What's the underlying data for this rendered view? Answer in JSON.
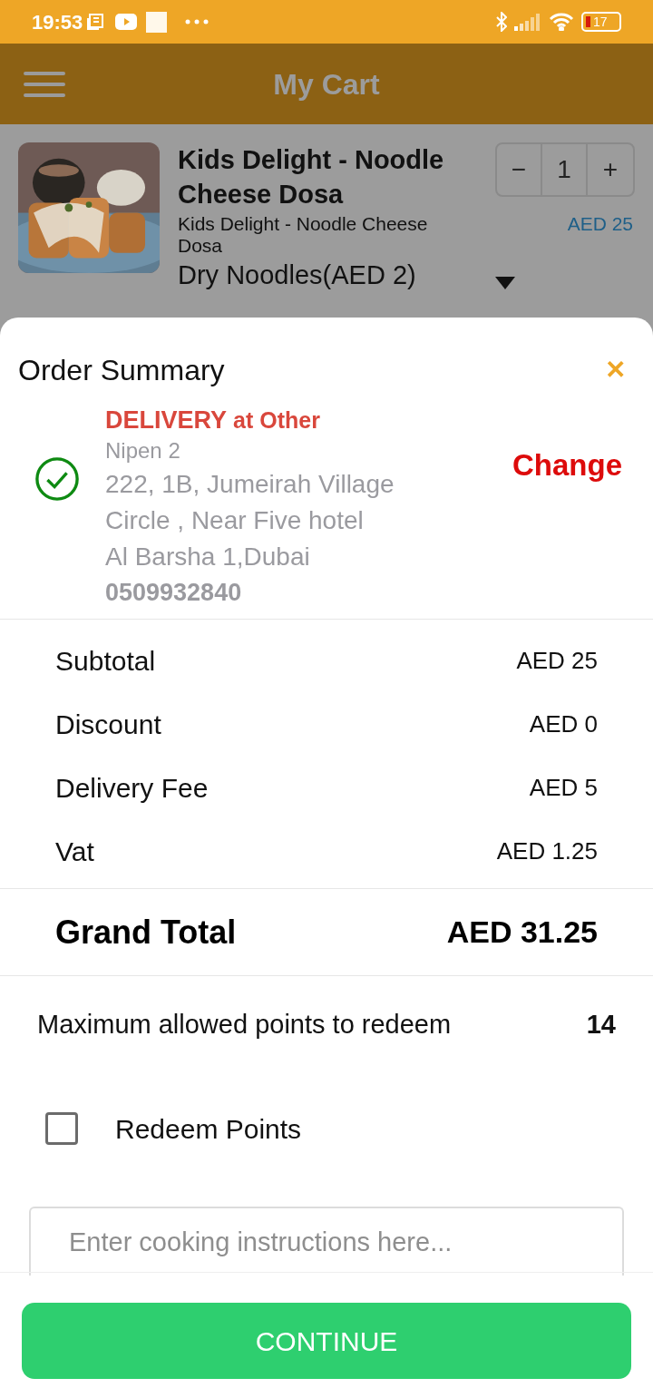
{
  "status_bar": {
    "time": "19:53",
    "battery": "17"
  },
  "header": {
    "title": "My Cart"
  },
  "cart_item": {
    "name": "Kids Delight - Noodle Cheese Dosa",
    "description": "Kids Delight - Noodle Cheese Dosa",
    "addon": "Dry Noodles(AED 2)",
    "quantity": "1",
    "price": "AED 25",
    "minus": "−",
    "plus": "+"
  },
  "order_summary": {
    "title": "Order Summary",
    "close": "✕",
    "address": {
      "selected": true,
      "type": "DELIVERY",
      "label": "at Other",
      "name": "Nipen 2",
      "lines": [
        "222, 1B, Jumeirah Village",
        "Circle , Near Five hotel",
        "Al Barsha 1,Dubai"
      ],
      "phone": "0509932840",
      "change": "Change"
    },
    "rows": [
      {
        "label": "Subtotal",
        "value": "AED 25"
      },
      {
        "label": "Discount",
        "value": "AED 0"
      },
      {
        "label": "Delivery Fee",
        "value": "AED 5"
      },
      {
        "label": "Vat",
        "value": "AED 1.25"
      }
    ],
    "grand_total": {
      "label": "Grand Total",
      "value": "AED 31.25"
    },
    "points": {
      "label": "Maximum allowed points to redeem",
      "value": "14"
    },
    "redeem": {
      "label": "Redeem Points",
      "checked": false
    },
    "instructions": {
      "placeholder": "Enter cooking instructions here..."
    },
    "continue": "CONTINUE"
  }
}
